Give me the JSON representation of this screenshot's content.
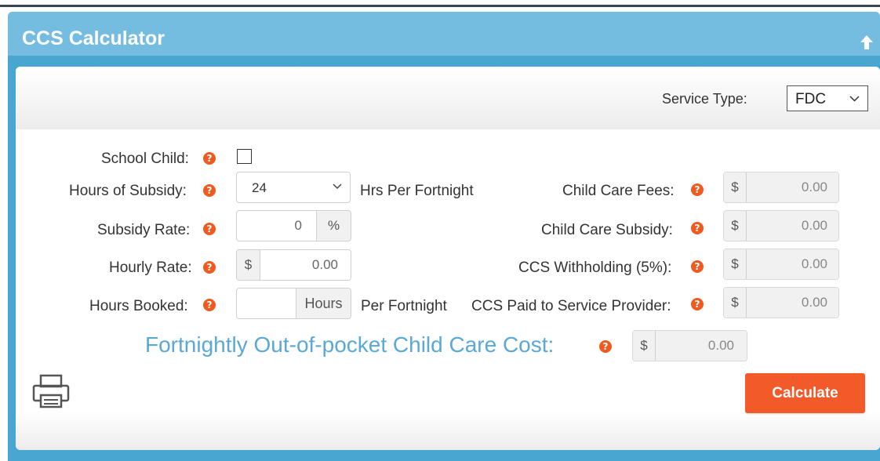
{
  "panel": {
    "title": "CCS Calculator"
  },
  "service_type": {
    "label": "Service Type:",
    "value": "FDC"
  },
  "school_child": {
    "label": "School Child:"
  },
  "hours_of_subsidy": {
    "label": "Hours of Subsidy:",
    "value": "24",
    "suffix": "Hrs Per Fortnight"
  },
  "subsidy_rate": {
    "label": "Subsidy Rate:",
    "value": "0",
    "unit": "%"
  },
  "hourly_rate": {
    "label": "Hourly Rate:",
    "currency": "$",
    "value": "0.00"
  },
  "hours_booked": {
    "label": "Hours Booked:",
    "value": "",
    "unit": "Hours",
    "suffix": "Per Fortnight"
  },
  "child_care_fees": {
    "label": "Child Care Fees:",
    "currency": "$",
    "value": "0.00"
  },
  "child_care_subsidy": {
    "label": "Child Care Subsidy:",
    "currency": "$",
    "value": "0.00"
  },
  "ccs_withholding": {
    "label": "CCS Withholding (5%):",
    "currency": "$",
    "value": "0.00"
  },
  "ccs_paid": {
    "label": "CCS Paid to Service Provider:",
    "currency": "$",
    "value": "0.00"
  },
  "out_of_pocket": {
    "label": "Fortnightly Out-of-pocket Child Care Cost:",
    "currency": "$",
    "value": "0.00"
  },
  "help_glyph": "?",
  "actions": {
    "calculate": "Calculate"
  },
  "colors": {
    "header": "#75bde0",
    "panel": "#49a6d0",
    "accent": "#f35a2a",
    "big_label": "#5aa9d4"
  },
  "icons": [
    "collapse-up-icon",
    "help-icon",
    "chevron-down-icon",
    "printer-icon"
  ]
}
